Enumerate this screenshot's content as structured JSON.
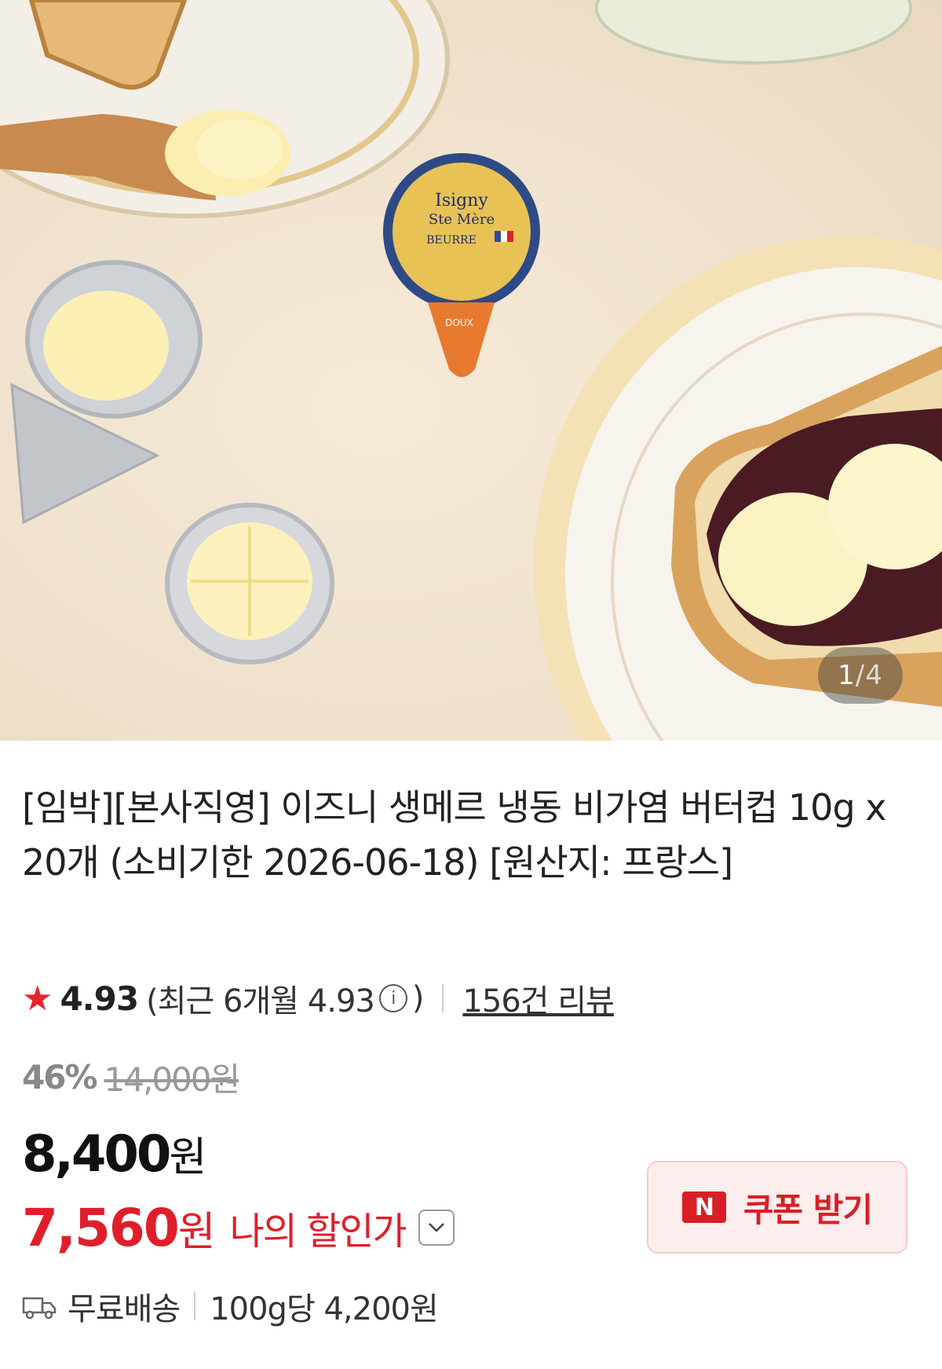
{
  "gallery": {
    "counter_current": "1",
    "counter_total": "4",
    "counter_sep": " / "
  },
  "product": {
    "title": "[임박][본사직영] 이즈니 생메르 냉동 비가염 버터컵 10g x 20개 (소비기한 2026-06-18) [원산지: 프랑스]",
    "package_label": {
      "brand1": "Isigny",
      "brand2": "Ste Mère",
      "type": "BEURRE",
      "tab": "DOUX"
    }
  },
  "rating": {
    "star_icon": "star-icon",
    "score": "4.93",
    "recent_prefix": "(최근 6개월 4.93",
    "recent_suffix": ")",
    "info_icon": "ⓘ",
    "reviews": "156건 리뷰"
  },
  "pricing": {
    "discount_pct": "46%",
    "original_price": "14,000원",
    "price_num": "8,400",
    "price_unit": "원",
    "my_price_num": "7,560",
    "my_price_unit": "원",
    "my_price_label": "나의 할인가",
    "coupon_badge": "N",
    "coupon_label": "쿠폰 받기"
  },
  "shipping": {
    "icon": "truck-icon",
    "label": "무료배송",
    "unit_price": "100g당 4,200원"
  },
  "colors": {
    "accent": "#e01e2b",
    "coupon_bg": "#fdeeee"
  }
}
